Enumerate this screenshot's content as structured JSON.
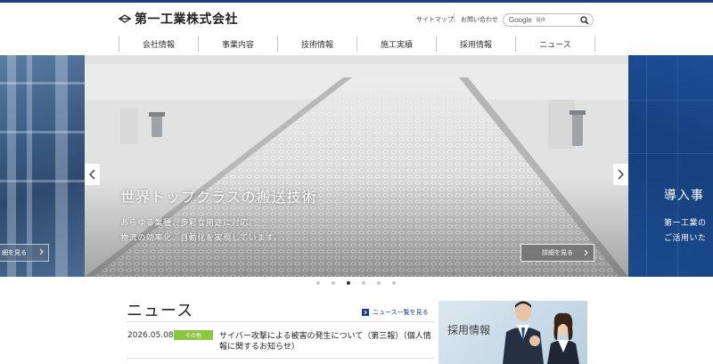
{
  "brand": {
    "name": "第一工業株式会社",
    "accent_color": "#1f3a8a"
  },
  "utility": {
    "sitemap": "サイトマップ",
    "contact": "お問い合わせ"
  },
  "search": {
    "placeholder_brand": "Google",
    "placeholder_suffix": "提供",
    "icon": "search-icon"
  },
  "nav": {
    "items": [
      {
        "label": "会社情報"
      },
      {
        "label": "事業内容"
      },
      {
        "label": "技術情報"
      },
      {
        "label": "施工実績"
      },
      {
        "label": "採用情報"
      },
      {
        "label": "ニュース"
      }
    ]
  },
  "hero": {
    "left_button": "細を見る",
    "title": "世界トップクラスの搬送技術",
    "subtitle_line1": "あらゆる業種、多彩な用途に対応。",
    "subtitle_line2": "物流の効率化、自動化を実現しています。",
    "detail_button": "詳細を見る",
    "next_slide": {
      "title": "導入事",
      "sub_line1": "第一工業の",
      "sub_line2": "ご活用いた"
    },
    "slide_count": 6,
    "active_slide": 3
  },
  "news": {
    "heading": "ニュース",
    "all_link": "ニュース一覧を見る",
    "items": [
      {
        "date": "2026.05.08",
        "category": "その他",
        "category_color": "#8cc63f",
        "text": "サイバー攻撃による被害の発生について（第三報）（個人情報に関するお知らせ）"
      }
    ]
  },
  "recruit_banner": {
    "label": "採用情報"
  }
}
